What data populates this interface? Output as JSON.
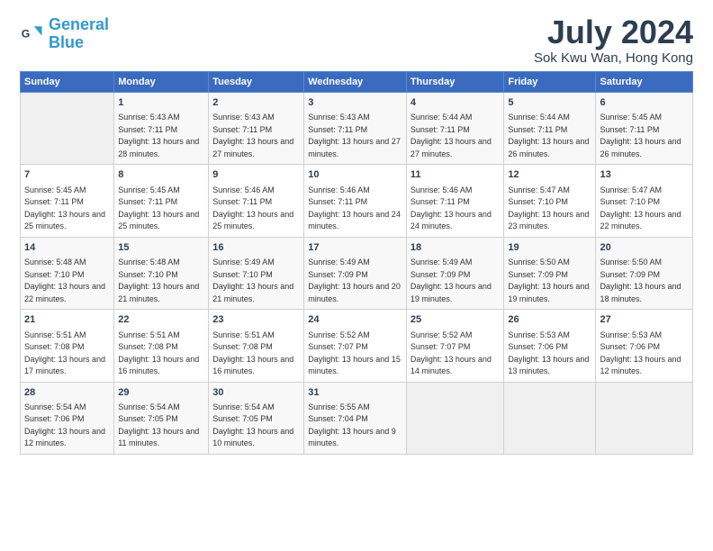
{
  "logo": {
    "line1": "General",
    "line2": "Blue"
  },
  "title": "July 2024",
  "location": "Sok Kwu Wan, Hong Kong",
  "headers": [
    "Sunday",
    "Monday",
    "Tuesday",
    "Wednesday",
    "Thursday",
    "Friday",
    "Saturday"
  ],
  "rows": [
    [
      {
        "day": "",
        "empty": true
      },
      {
        "day": "1",
        "sunrise": "5:43 AM",
        "sunset": "7:11 PM",
        "daylight": "13 hours and 28 minutes."
      },
      {
        "day": "2",
        "sunrise": "5:43 AM",
        "sunset": "7:11 PM",
        "daylight": "13 hours and 27 minutes."
      },
      {
        "day": "3",
        "sunrise": "5:43 AM",
        "sunset": "7:11 PM",
        "daylight": "13 hours and 27 minutes."
      },
      {
        "day": "4",
        "sunrise": "5:44 AM",
        "sunset": "7:11 PM",
        "daylight": "13 hours and 27 minutes."
      },
      {
        "day": "5",
        "sunrise": "5:44 AM",
        "sunset": "7:11 PM",
        "daylight": "13 hours and 26 minutes."
      },
      {
        "day": "6",
        "sunrise": "5:45 AM",
        "sunset": "7:11 PM",
        "daylight": "13 hours and 26 minutes."
      }
    ],
    [
      {
        "day": "7",
        "sunrise": "5:45 AM",
        "sunset": "7:11 PM",
        "daylight": "13 hours and 25 minutes."
      },
      {
        "day": "8",
        "sunrise": "5:45 AM",
        "sunset": "7:11 PM",
        "daylight": "13 hours and 25 minutes."
      },
      {
        "day": "9",
        "sunrise": "5:46 AM",
        "sunset": "7:11 PM",
        "daylight": "13 hours and 25 minutes."
      },
      {
        "day": "10",
        "sunrise": "5:46 AM",
        "sunset": "7:11 PM",
        "daylight": "13 hours and 24 minutes."
      },
      {
        "day": "11",
        "sunrise": "5:46 AM",
        "sunset": "7:11 PM",
        "daylight": "13 hours and 24 minutes."
      },
      {
        "day": "12",
        "sunrise": "5:47 AM",
        "sunset": "7:10 PM",
        "daylight": "13 hours and 23 minutes."
      },
      {
        "day": "13",
        "sunrise": "5:47 AM",
        "sunset": "7:10 PM",
        "daylight": "13 hours and 22 minutes."
      }
    ],
    [
      {
        "day": "14",
        "sunrise": "5:48 AM",
        "sunset": "7:10 PM",
        "daylight": "13 hours and 22 minutes."
      },
      {
        "day": "15",
        "sunrise": "5:48 AM",
        "sunset": "7:10 PM",
        "daylight": "13 hours and 21 minutes."
      },
      {
        "day": "16",
        "sunrise": "5:49 AM",
        "sunset": "7:10 PM",
        "daylight": "13 hours and 21 minutes."
      },
      {
        "day": "17",
        "sunrise": "5:49 AM",
        "sunset": "7:09 PM",
        "daylight": "13 hours and 20 minutes."
      },
      {
        "day": "18",
        "sunrise": "5:49 AM",
        "sunset": "7:09 PM",
        "daylight": "13 hours and 19 minutes."
      },
      {
        "day": "19",
        "sunrise": "5:50 AM",
        "sunset": "7:09 PM",
        "daylight": "13 hours and 19 minutes."
      },
      {
        "day": "20",
        "sunrise": "5:50 AM",
        "sunset": "7:09 PM",
        "daylight": "13 hours and 18 minutes."
      }
    ],
    [
      {
        "day": "21",
        "sunrise": "5:51 AM",
        "sunset": "7:08 PM",
        "daylight": "13 hours and 17 minutes."
      },
      {
        "day": "22",
        "sunrise": "5:51 AM",
        "sunset": "7:08 PM",
        "daylight": "13 hours and 16 minutes."
      },
      {
        "day": "23",
        "sunrise": "5:51 AM",
        "sunset": "7:08 PM",
        "daylight": "13 hours and 16 minutes."
      },
      {
        "day": "24",
        "sunrise": "5:52 AM",
        "sunset": "7:07 PM",
        "daylight": "13 hours and 15 minutes."
      },
      {
        "day": "25",
        "sunrise": "5:52 AM",
        "sunset": "7:07 PM",
        "daylight": "13 hours and 14 minutes."
      },
      {
        "day": "26",
        "sunrise": "5:53 AM",
        "sunset": "7:06 PM",
        "daylight": "13 hours and 13 minutes."
      },
      {
        "day": "27",
        "sunrise": "5:53 AM",
        "sunset": "7:06 PM",
        "daylight": "13 hours and 12 minutes."
      }
    ],
    [
      {
        "day": "28",
        "sunrise": "5:54 AM",
        "sunset": "7:06 PM",
        "daylight": "13 hours and 12 minutes."
      },
      {
        "day": "29",
        "sunrise": "5:54 AM",
        "sunset": "7:05 PM",
        "daylight": "13 hours and 11 minutes."
      },
      {
        "day": "30",
        "sunrise": "5:54 AM",
        "sunset": "7:05 PM",
        "daylight": "13 hours and 10 minutes."
      },
      {
        "day": "31",
        "sunrise": "5:55 AM",
        "sunset": "7:04 PM",
        "daylight": "13 hours and 9 minutes."
      },
      {
        "day": "",
        "empty": true
      },
      {
        "day": "",
        "empty": true
      },
      {
        "day": "",
        "empty": true
      }
    ]
  ]
}
